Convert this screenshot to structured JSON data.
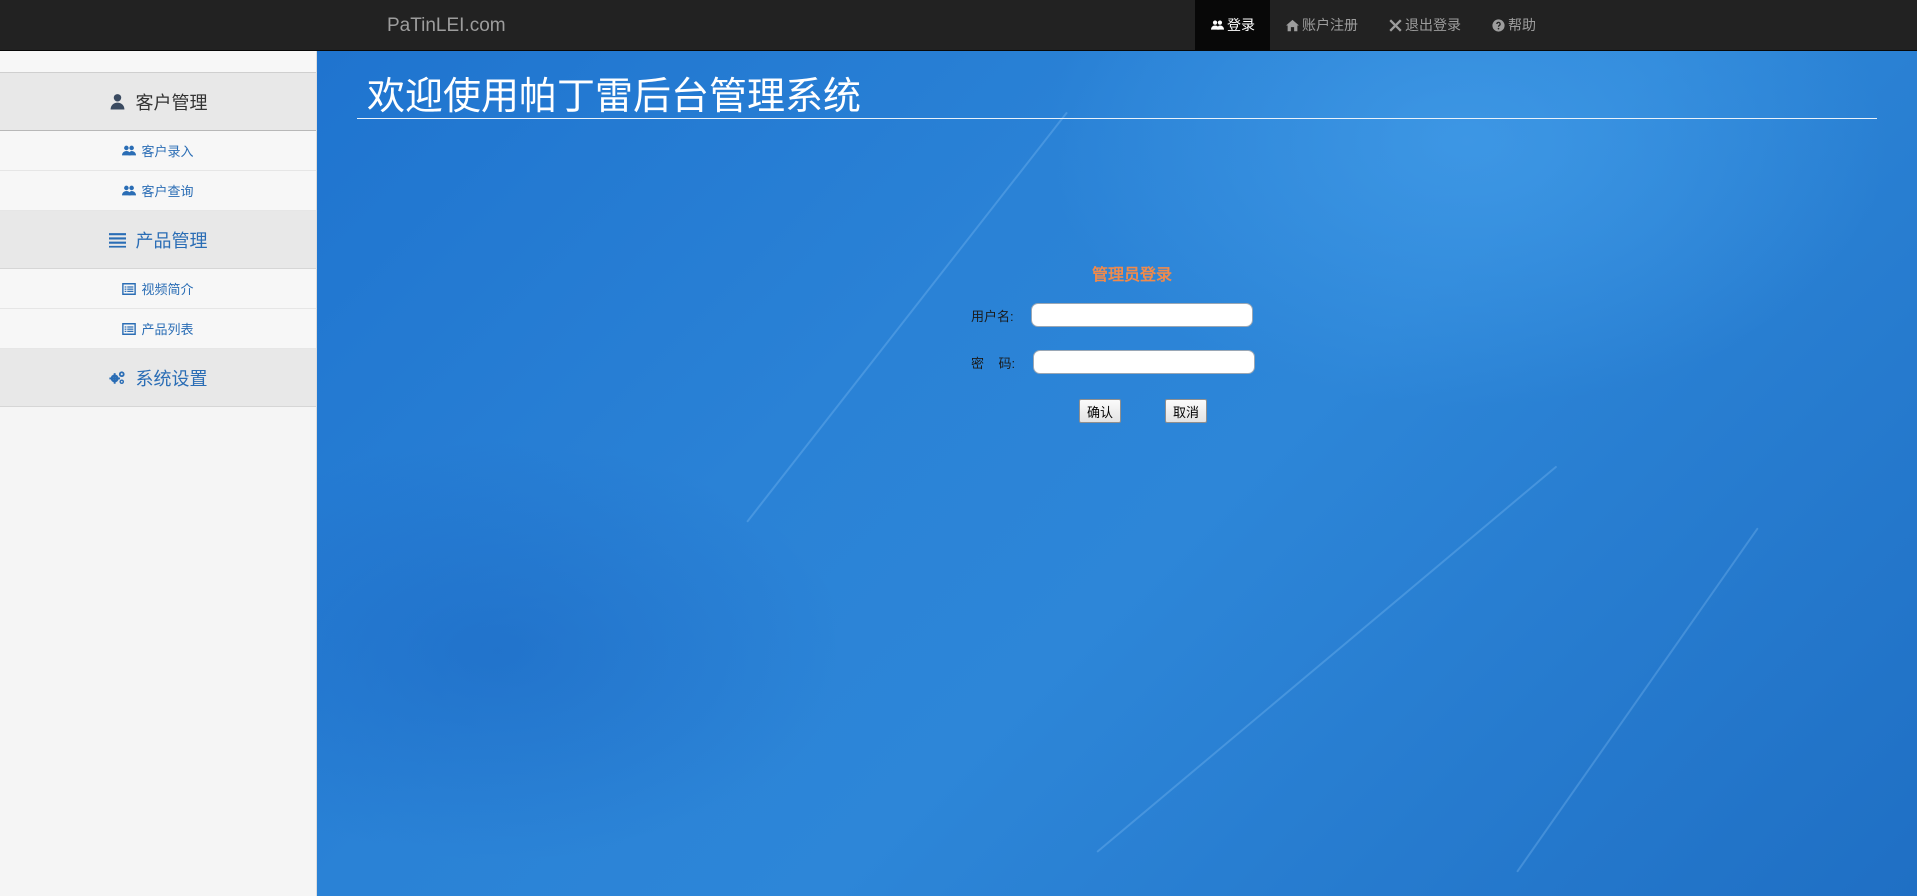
{
  "navbar": {
    "brand": "PaTinLEI.com",
    "links": [
      {
        "label": "登录",
        "icon": "users-icon",
        "active": true
      },
      {
        "label": "账户注册",
        "icon": "home-icon",
        "active": false
      },
      {
        "label": "退出登录",
        "icon": "close-icon",
        "active": false
      },
      {
        "label": "帮助",
        "icon": "question-circle-icon",
        "active": false
      }
    ]
  },
  "sidebar": {
    "groups": [
      {
        "label": "客户管理",
        "icon": "user-icon",
        "items": [
          {
            "label": "客户录入",
            "icon": "users-icon"
          },
          {
            "label": "客户查询",
            "icon": "users-icon"
          }
        ]
      },
      {
        "label": "产品管理",
        "icon": "list-icon",
        "items": [
          {
            "label": "视频简介",
            "icon": "list-alt-icon"
          },
          {
            "label": "产品列表",
            "icon": "list-alt-icon"
          }
        ]
      },
      {
        "label": "系统设置",
        "icon": "gears-icon",
        "items": []
      }
    ]
  },
  "main": {
    "title": "欢迎使用帕丁雷后台管理系统",
    "login": {
      "title": "管理员登录",
      "username_label": "用户名:",
      "username_value": "",
      "password_label": "密    码:",
      "password_value": "",
      "confirm_label": "确认",
      "cancel_label": "取消"
    }
  },
  "colors": {
    "navbar_bg": "#222222",
    "nav_active_bg": "#080808",
    "link_blue": "#2a6db5",
    "login_title": "#f08a4b",
    "main_bg": "#2a82d6"
  }
}
